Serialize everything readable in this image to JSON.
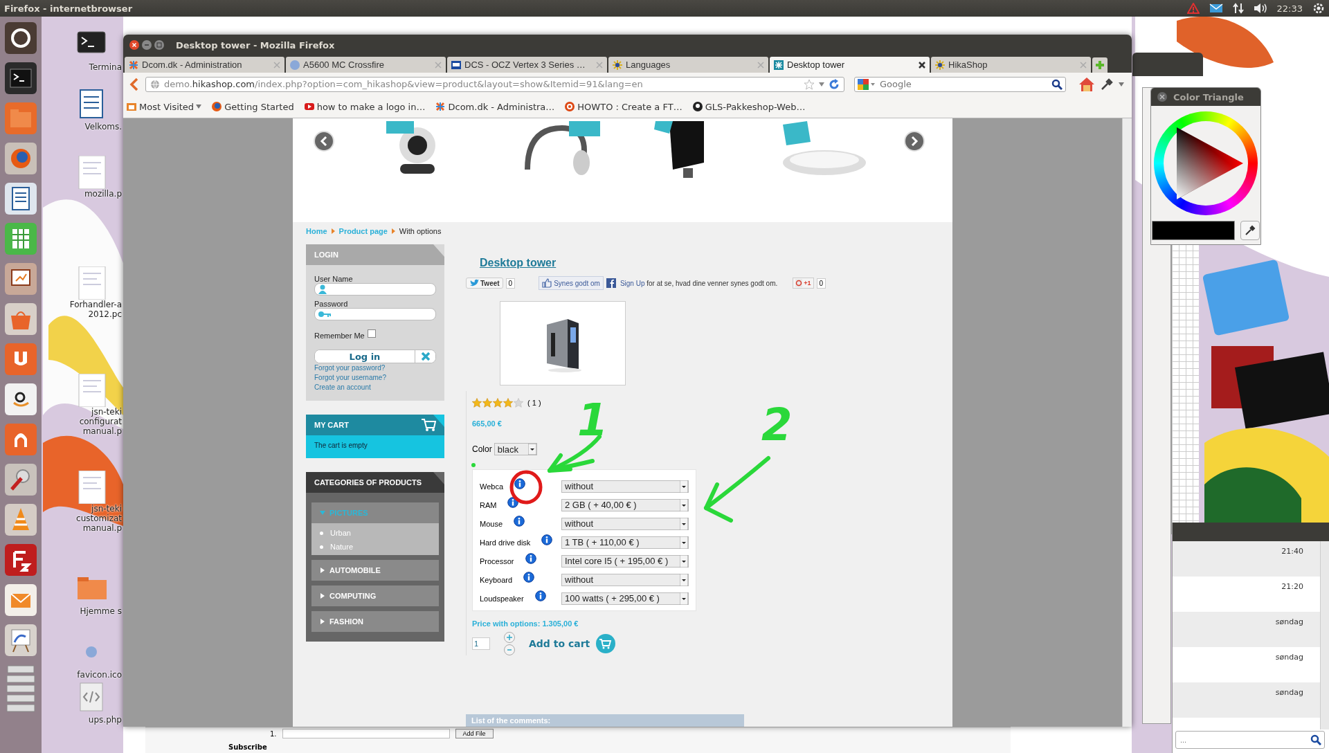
{
  "top_panel": {
    "title": "Firefox - internetbrowser",
    "clock": "22:33"
  },
  "desktop_icons": [
    {
      "kind": "terminal",
      "lines": [
        "Termina"
      ]
    },
    {
      "kind": "document",
      "lines": [
        "Velkoms."
      ]
    },
    {
      "kind": "pdf",
      "lines": [
        "mozilla.p"
      ]
    },
    {
      "kind": "pdf",
      "lines": [
        "Forhandler-a",
        "2012.pc"
      ]
    },
    {
      "kind": "pdf",
      "lines": [
        "jsn-teki",
        "configurat",
        "manual.p"
      ]
    },
    {
      "kind": "pdf",
      "lines": [
        "jsn-teki",
        "customizat",
        "manual.p"
      ]
    },
    {
      "kind": "folder",
      "lines": [
        "Hjemme s"
      ]
    },
    {
      "kind": "favicon",
      "lines": [
        "favicon.ico"
      ]
    },
    {
      "kind": "code",
      "lines": [
        "ups.php"
      ]
    }
  ],
  "browser": {
    "title": "Desktop tower - Mozilla Firefox",
    "tabs": [
      {
        "label": "Dcom.dk - Administration",
        "selected": false
      },
      {
        "label": "A5600 MC Crossfire",
        "selected": false
      },
      {
        "label": "DCS - OCZ Vertex 3 Series …",
        "selected": false
      },
      {
        "label": "Languages",
        "selected": false
      },
      {
        "label": "Desktop tower",
        "selected": true
      },
      {
        "label": "HikaShop",
        "selected": false
      }
    ],
    "url": "demo.**hikashop.com**/index.php?option=com_hikashop&view=product&layout=show&Itemid=91&lang=en",
    "search": {
      "placeholder": "Google"
    },
    "bookmarks": [
      {
        "kind": "folder",
        "label": "Most Visited"
      },
      {
        "kind": "link",
        "label": "Getting Started"
      },
      {
        "kind": "link",
        "label": "how to make a logo in…"
      },
      {
        "kind": "link",
        "label": "Dcom.dk - Administra…"
      },
      {
        "kind": "link",
        "label": "HOWTO : Create a FT…"
      },
      {
        "kind": "link",
        "label": "GLS-Pakkeshop-Web…"
      }
    ]
  },
  "page": {
    "breadcrumb": [
      "Home",
      "Product page",
      "With options"
    ],
    "login": {
      "title": "LOGIN",
      "username_label": "User Name",
      "password_label": "Password",
      "remember_label": "Remember Me",
      "remember_checked": false,
      "button": "Log in",
      "links": [
        "Forgot your password?",
        "Forgot your username?",
        "Create an account"
      ]
    },
    "cart": {
      "title": "MY CART",
      "message": "The cart is empty"
    },
    "categories": {
      "title": "CATEGORIES OF PRODUCTS",
      "items": [
        {
          "label": "PICTURES",
          "expanded": true,
          "children": [
            {
              "label": "Urban"
            },
            {
              "label": "Nature"
            }
          ]
        },
        {
          "label": "AUTOMOBILE",
          "expanded": false
        },
        {
          "label": "COMPUTING",
          "expanded": false
        },
        {
          "label": "FASHION",
          "expanded": false
        }
      ]
    },
    "product": {
      "title": "Desktop tower",
      "tweet": "Tweet",
      "tweet_count": "0",
      "like": "Synes godt om",
      "signup_link": "Sign Up",
      "signup_text": "for at se, hvad dine venner synes godt om.",
      "plusone": "+1",
      "plusone_count": "0",
      "stars": 4,
      "rating_count": "( 1 )",
      "price": "665,00 €",
      "color_label": "Color",
      "color_value": "black",
      "options": [
        {
          "label": "Webca",
          "value": "without"
        },
        {
          "label": "RAM",
          "value": "2 GB ( + 40,00 € )"
        },
        {
          "label": "Mouse",
          "value": "without"
        },
        {
          "label": "Hard drive disk",
          "value": "1 TB ( + 110,00 € )"
        },
        {
          "label": "Processor",
          "value": "Intel core I5 ( + 195,00 € )"
        },
        {
          "label": "Keyboard",
          "value": "without"
        },
        {
          "label": "Loudspeaker",
          "value": "100 watts ( + 295,00 € )"
        }
      ],
      "total": "Price with options: 1.305,00 €",
      "quantity": "1",
      "add_to_cart": "Add to cart"
    },
    "comments_title": "List of the comments:"
  },
  "annotations": [
    {
      "text": "1"
    },
    {
      "text": "2"
    }
  ],
  "color_triangle": {
    "title": "Color Triangle"
  },
  "message_list": {
    "times": [
      "21:40",
      "21:20",
      "søndag",
      "søndag",
      "søndag"
    ],
    "search": {
      "placeholder": "..."
    }
  },
  "background_form": {
    "row_number": "1.",
    "button": "Add File",
    "label": "Subscribe"
  }
}
